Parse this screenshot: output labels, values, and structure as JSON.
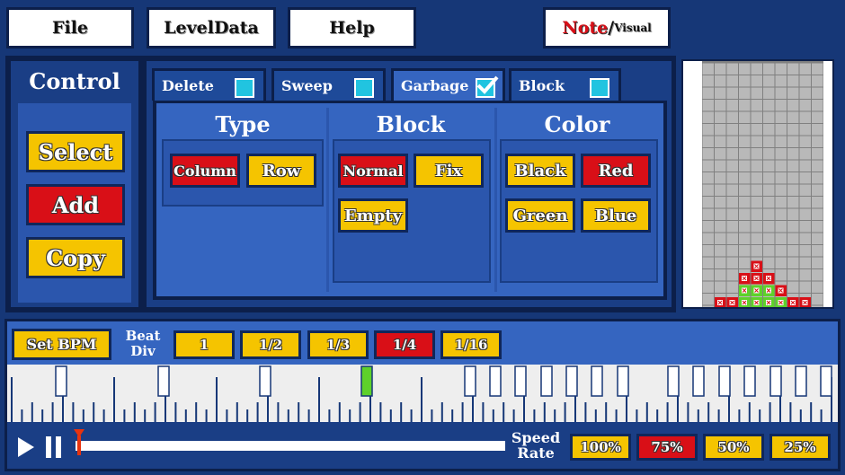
{
  "topbar": {
    "file": "File",
    "leveldata": "LevelData",
    "help": "Help",
    "note": "Note",
    "visual": "Visual",
    "separator": "/"
  },
  "control": {
    "title": "Control",
    "select": "Select",
    "add": "Add",
    "copy": "Copy"
  },
  "tabs": [
    {
      "label": "Delete",
      "checked": false
    },
    {
      "label": "Sweep",
      "checked": false
    },
    {
      "label": "Garbage",
      "checked": true
    },
    {
      "label": "Block",
      "checked": false
    }
  ],
  "type": {
    "title": "Type",
    "column": "Column",
    "row": "Row"
  },
  "block": {
    "title": "Block",
    "normal": "Normal",
    "fix": "Fix",
    "empty": "Empty"
  },
  "color": {
    "title": "Color",
    "black": "Black",
    "red": "Red",
    "green": "Green",
    "blue": "Blue"
  },
  "timeline": {
    "set_bpm": "Set BPM",
    "beat_label": "Beat",
    "div_label": "Div",
    "divs": [
      "1",
      "1/2",
      "1/3",
      "1/4",
      "1/16"
    ],
    "selected_div": "1/4"
  },
  "playback": {
    "speed": "Speed",
    "rate": "Rate",
    "rates": [
      "100%",
      "75%",
      "50%",
      "25%"
    ],
    "selected_rate": "75%",
    "progress": 0.01
  },
  "colors": {
    "accent_yellow": "#f5c400",
    "accent_red": "#d90f17",
    "panel_blue": "#1a3e85",
    "cyan": "#21c4e0",
    "green_note": "#5ed12a"
  }
}
